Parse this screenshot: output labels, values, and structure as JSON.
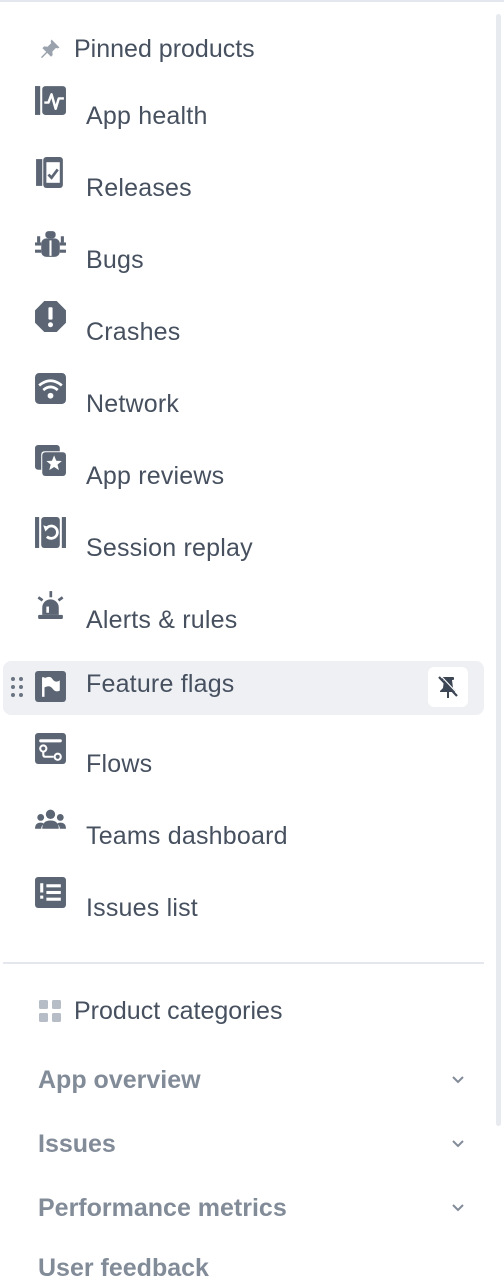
{
  "pinned": {
    "title": "Pinned products",
    "items": [
      {
        "label": "App health",
        "icon": "app-health-icon"
      },
      {
        "label": "Releases",
        "icon": "releases-icon"
      },
      {
        "label": "Bugs",
        "icon": "bug-icon"
      },
      {
        "label": "Crashes",
        "icon": "crash-icon"
      },
      {
        "label": "Network",
        "icon": "wifi-icon"
      },
      {
        "label": "App reviews",
        "icon": "app-reviews-icon"
      },
      {
        "label": "Session replay",
        "icon": "session-replay-icon"
      },
      {
        "label": "Alerts & rules",
        "icon": "siren-icon"
      },
      {
        "label": "Feature flags",
        "icon": "flag-icon",
        "active": true
      },
      {
        "label": "Flows",
        "icon": "flows-icon"
      },
      {
        "label": "Teams dashboard",
        "icon": "teams-icon"
      },
      {
        "label": "Issues list",
        "icon": "list-icon"
      }
    ]
  },
  "categories": {
    "title": "Product categories",
    "items": [
      {
        "label": "App overview"
      },
      {
        "label": "Issues"
      },
      {
        "label": "Performance metrics"
      },
      {
        "label": "User feedback"
      }
    ]
  },
  "colors": {
    "text": "#46505f",
    "muted": "#828b98",
    "icon": "#5b6573",
    "active_bg": "#eef0f4",
    "divider": "#e4e8ee"
  }
}
